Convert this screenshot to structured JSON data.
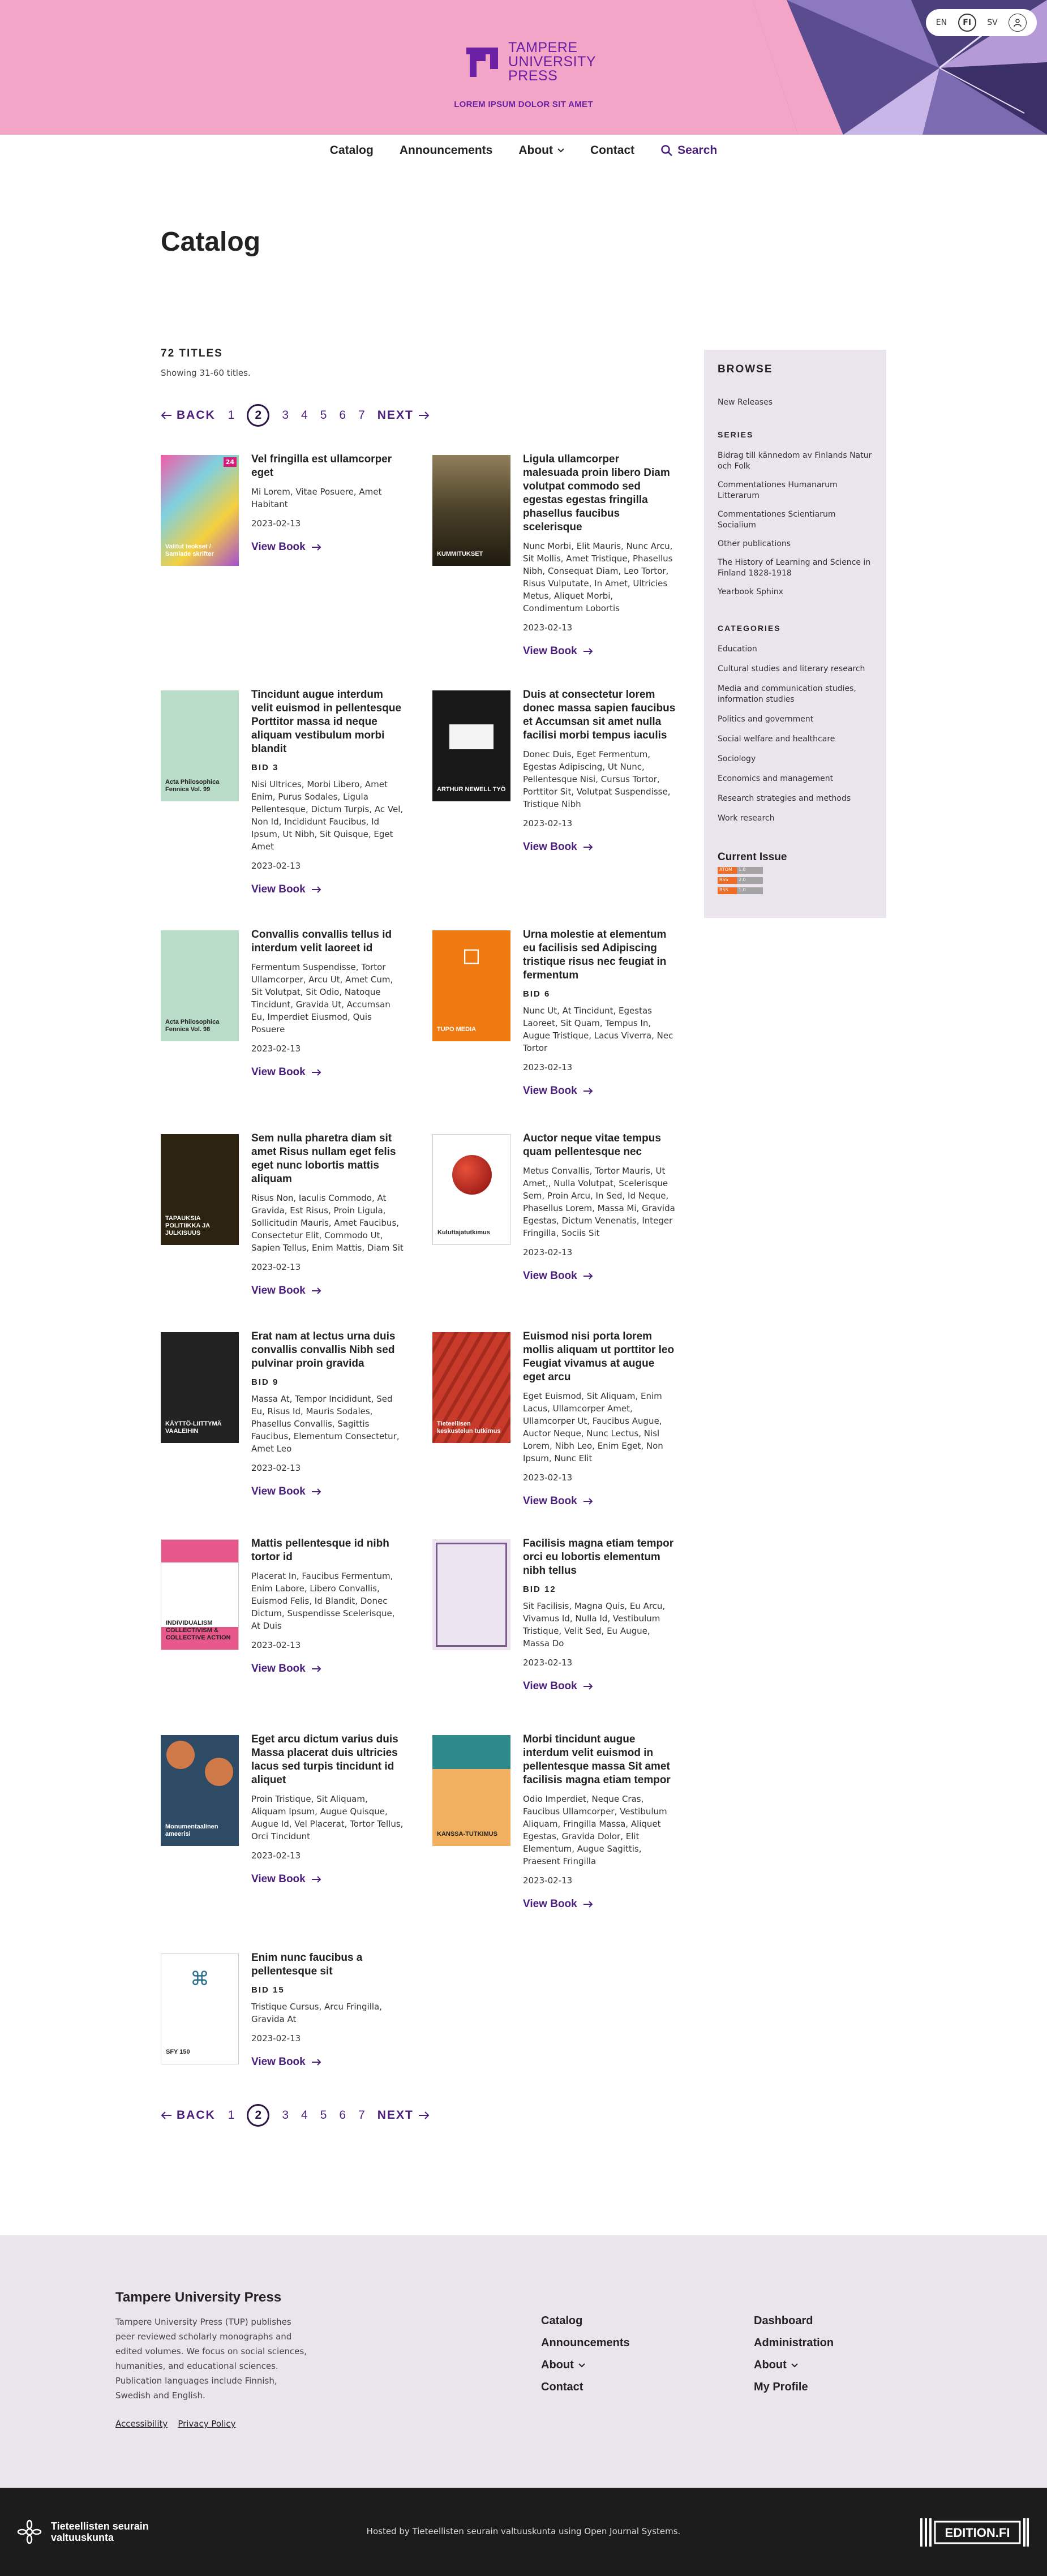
{
  "header": {
    "logo_lines": [
      "TAMPERE",
      "UNIVERSITY",
      "PRESS"
    ],
    "tagline": "LOREM IPSUM DOLOR SIT AMET",
    "languages": [
      "EN",
      "FI",
      "SV"
    ],
    "active_language": "FI",
    "brand_color": "#6b1fa3",
    "bg_color": "#f3a5c8"
  },
  "nav": {
    "catalog": "Catalog",
    "announcements": "Announcements",
    "about": "About",
    "contact": "Contact",
    "search": "Search"
  },
  "page_title": "Catalog",
  "listing": {
    "count": "72 TITLES",
    "showing": "Showing 31-60 titles."
  },
  "pager": {
    "back": "BACK",
    "next": "NEXT",
    "pages": [
      "1",
      "2",
      "3",
      "4",
      "5",
      "6",
      "7"
    ],
    "current": "2"
  },
  "view_label": "View Book",
  "books": [
    {
      "title": "Vel fringilla est ullamcorper eget",
      "bid": "",
      "authors": "Mi Lorem, Vitae Posuere, Amet Habitant",
      "date": "2023-02-13"
    },
    {
      "title": "Ligula ullamcorper malesuada proin libero Diam volutpat commodo sed egestas egestas fringilla phasellus faucibus scelerisque",
      "bid": "",
      "authors": "Nunc Morbi, Elit Mauris, Nunc Arcu, Sit Mollis, Amet Tristique, Phasellus Nibh, Consequat Diam, Leo Tortor, Risus Vulputate, In Amet, Ultricies Metus, Aliquet Morbi, Condimentum Lobortis",
      "date": "2023-02-13"
    },
    {
      "title": "Tincidunt augue interdum velit euismod in pellentesque Porttitor massa id neque aliquam vestibulum morbi blandit",
      "bid": "BID 3",
      "authors": "Nisi Ultrices, Morbi Libero, Amet Enim, Purus Sodales, Ligula Pellentesque, Dictum Turpis, Ac Vel, Non Id, Incididunt Faucibus, Id Ipsum, Ut Nibh, Sit Quisque, Eget Amet",
      "date": "2023-02-13"
    },
    {
      "title": "Duis at consectetur lorem donec massa sapien faucibus et Accumsan sit amet nulla facilisi morbi tempus iaculis",
      "bid": "",
      "authors": "Donec Duis, Eget Fermentum, Egestas Adipiscing, Ut Nunc, Pellentesque Nisi, Cursus Tortor, Porttitor Sit, Volutpat Suspendisse, Tristique Nibh",
      "date": "2023-02-13"
    },
    {
      "title": "Convallis convallis tellus id interdum velit laoreet id",
      "bid": "",
      "authors": "Fermentum Suspendisse, Tortor Ullamcorper, Arcu Ut, Amet Cum, Sit Volutpat, Sit Odio, Natoque Tincidunt, Gravida Ut, Accumsan Eu, Imperdiet Eiusmod, Quis Posuere",
      "date": "2023-02-13"
    },
    {
      "title": "Urna molestie at elementum eu facilisis sed Adipiscing tristique risus nec feugiat in fermentum",
      "bid": "BID 6",
      "authors": "Nunc Ut, At Tincidunt, Egestas Laoreet, Sit Quam, Tempus In, Augue Tristique, Lacus Viverra, Nec Tortor",
      "date": "2023-02-13"
    },
    {
      "title": "Sem nulla pharetra diam sit amet Risus nullam eget felis eget nunc lobortis mattis aliquam",
      "bid": "",
      "authors": "Risus Non, Iaculis Commodo, At Gravida, Est Risus, Proin Ligula, Sollicitudin Mauris, Amet Faucibus, Consectetur Elit, Commodo Ut, Sapien Tellus, Enim Mattis, Diam Sit",
      "date": "2023-02-13"
    },
    {
      "title": "Auctor neque vitae tempus quam pellentesque nec",
      "bid": "",
      "authors": "Metus Convallis, Tortor Mauris, Ut Amet,, Nulla Volutpat, Scelerisque Sem, Proin Arcu, In Sed, Id Neque, Phasellus Lorem, Massa Mi, Gravida Egestas, Dictum Venenatis, Integer Fringilla, Sociis Sit",
      "date": "2023-02-13"
    },
    {
      "title": "Erat nam at lectus urna duis convallis convallis Nibh sed pulvinar proin gravida",
      "bid": "BID 9",
      "authors": "Massa At, Tempor Incididunt, Sed Eu, Risus Id, Mauris Sodales, Phasellus Convallis, Sagittis Faucibus, Elementum Consectetur, Amet Leo",
      "date": "2023-02-13"
    },
    {
      "title": "Euismod nisi porta lorem mollis aliquam ut porttitor leo Feugiat vivamus at augue eget arcu",
      "bid": "",
      "authors": "Eget Euismod, Sit Aliquam, Enim Lacus, Ullamcorper Amet, Ullamcorper Ut, Faucibus Augue, Auctor Neque, Nunc Lectus, Nisl Lorem, Nibh Leo, Enim Eget, Non Ipsum, Nunc Elit",
      "date": "2023-02-13"
    },
    {
      "title": "Mattis pellentesque id nibh tortor id",
      "bid": "",
      "authors": "Placerat In, Faucibus Fermentum, Enim Labore, Libero Convallis, Euismod Felis, Id Blandit, Donec Dictum, Suspendisse Scelerisque, At Duis",
      "date": "2023-02-13"
    },
    {
      "title": "Facilisis magna etiam tempor orci eu lobortis elementum nibh tellus",
      "bid": "BID 12",
      "authors": "Sit Facilisis, Magna Quis, Eu Arcu, Vivamus Id, Nulla Id, Vestibulum Tristique, Velit Sed, Eu Augue, Massa Do",
      "date": "2023-02-13"
    },
    {
      "title": "Eget arcu dictum varius duis Massa placerat duis ultricies lacus sed turpis tincidunt id aliquet",
      "bid": "",
      "authors": "Proin Tristique, Sit Aliquam, Aliquam Ipsum, Augue Quisque, Augue Id, Vel Placerat, Tortor Tellus, Orci Tincidunt",
      "date": "2023-02-13"
    },
    {
      "title": "Morbi tincidunt augue interdum velit euismod in pellentesque massa Sit amet facilisis magna etiam tempor",
      "bid": "",
      "authors": "Odio Imperdiet, Neque Cras, Faucibus Ullamcorper, Vestibulum Aliquam, Fringilla Massa, Aliquet Egestas, Gravida Dolor, Elit Elementum, Augue Sagittis, Praesent Fringilla",
      "date": "2023-02-13"
    },
    {
      "title": "Enim nunc faucibus a pellentesque sit",
      "bid": "BID 15",
      "authors": "Tristique Cursus, Arcu Fringilla, Gravida At",
      "date": "2023-02-13"
    }
  ],
  "covers": [
    {
      "label": "Valitut teokset / Samlade skrifter",
      "badge": "24",
      "color": "#c8408f"
    },
    {
      "label": "KUMMITUKSET",
      "color": "#3b3322"
    },
    {
      "label": "Acta Philosophica Fennica Vol. 99",
      "color": "#b9dcc8"
    },
    {
      "label": "ARTHUR NEWELL TYÖ",
      "color": "#181818"
    },
    {
      "label": "Acta Philosophica Fennica Vol. 98",
      "color": "#b9dcc8"
    },
    {
      "label": "TUPO MEDIA",
      "color": "#ef7a12"
    },
    {
      "label": "TAPAUKSIA POLITIIKKA JA JULKISUUS",
      "color": "#2c2410"
    },
    {
      "label": "Kuluttajatutkimus",
      "color": "#ffffff"
    },
    {
      "label": "KÄYTTÖ-LIITTYMÄ VAALEIHIN",
      "color": "#222222"
    },
    {
      "label": "Tieteellisen keskustelun tutkimus",
      "color": "#c83a2a"
    },
    {
      "label": "INDIVIDUALISM COLLECTIVISM & COLLECTIVE ACTION",
      "color": "#ffffff"
    },
    {
      "label": "",
      "color": "#ece4ee"
    },
    {
      "label": "Monumentaalinen ameerisi",
      "color": "#2e4b66"
    },
    {
      "label": "KANSSA-TUTKIMUS",
      "color": "#f0b060"
    },
    {
      "label": "SFY 150",
      "color": "#ffffff"
    }
  ],
  "sidebar": {
    "browse": "BROWSE",
    "new_releases": "New Releases",
    "series_heading": "SERIES",
    "series": [
      "Bidrag till kännedom av Finlands Natur och Folk",
      "Commentationes Humanarum Litterarum",
      "Commentationes Scientiarum Socialium",
      "Other publications",
      "The History of Learning and Science in Finland 1828-1918",
      "Yearbook Sphinx"
    ],
    "categories_heading": "CATEGORIES",
    "categories": [
      "Education",
      "Cultural studies and literary research",
      "Media and communication studies, information studies",
      "Politics and government",
      "Social welfare and healthcare",
      "Sociology",
      "Economics and management",
      "Research strategies and methods",
      "Work research"
    ],
    "current_issue": "Current Issue",
    "feeds": [
      {
        "left": "ATOM",
        "right": "1.0"
      },
      {
        "left": "RSS",
        "right": "2.0"
      },
      {
        "left": "RSS",
        "right": "1.0"
      }
    ]
  },
  "footer": {
    "title": "Tampere University Press",
    "description": "Tampere University Press (TUP) publishes peer reviewed scholarly monographs and edited volumes. We focus on social sciences, humanities, and educational sciences. Publication languages include Finnish, Swedish and English.",
    "accessibility": "Accessibility",
    "privacy": "Privacy Policy",
    "col1": [
      "Catalog",
      "Announcements",
      "About",
      "Contact"
    ],
    "col2": [
      "Dashboard",
      "Administration",
      "About",
      "My Profile"
    ]
  },
  "bottom": {
    "logo_line1": "Tieteellisten seurain",
    "logo_line2": "valtuuskunta",
    "hosted": "Hosted by Tieteellisten seurain valtuuskunta using Open Journal Systems.",
    "edition": "EDITION.FI"
  }
}
